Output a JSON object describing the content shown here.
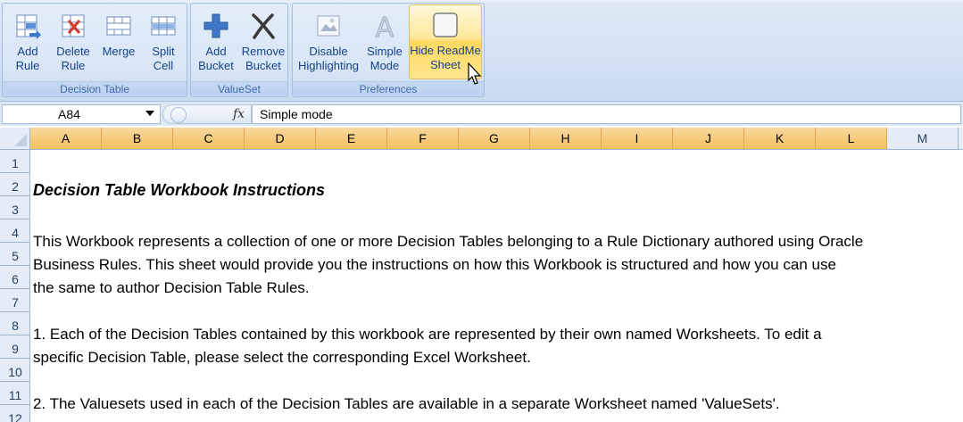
{
  "ribbon": {
    "groups": [
      {
        "label": "Decision Table",
        "buttons": [
          {
            "line1": "Add",
            "line2": "Rule",
            "icon": "add-rule-icon"
          },
          {
            "line1": "Delete",
            "line2": "Rule",
            "icon": "delete-rule-icon"
          },
          {
            "line1": "Merge",
            "line2": "",
            "icon": "merge-icon"
          },
          {
            "line1": "Split",
            "line2": "Cell",
            "icon": "split-cell-icon"
          }
        ]
      },
      {
        "label": "ValueSet",
        "buttons": [
          {
            "line1": "Add",
            "line2": "Bucket",
            "icon": "add-bucket-icon"
          },
          {
            "line1": "Remove",
            "line2": "Bucket",
            "icon": "remove-bucket-icon"
          }
        ]
      },
      {
        "label": "Preferences",
        "buttons": [
          {
            "line1": "Disable",
            "line2": "Highlighting",
            "icon": "disable-highlighting-icon"
          },
          {
            "line1": "Simple",
            "line2": "Mode",
            "icon": "simple-mode-icon"
          },
          {
            "line1": "Hide ReadMe",
            "line2": "Sheet",
            "icon": "hide-readme-icon",
            "active": true
          }
        ]
      }
    ]
  },
  "formula_bar": {
    "name_box": "A84",
    "fx": "fx",
    "content": "Simple mode"
  },
  "columns": [
    "A",
    "B",
    "C",
    "D",
    "E",
    "F",
    "G",
    "H",
    "I",
    "J",
    "K",
    "L",
    "M"
  ],
  "rows": [
    "1",
    "2",
    "3",
    "4",
    "5",
    "6",
    "7",
    "8",
    "9",
    "10",
    "11",
    "12"
  ],
  "sheet": {
    "title": "Decision Table Workbook Instructions",
    "para1_line1": "This Workbook represents a collection of one or more Decision Tables belonging to a Rule Dictionary authored using Oracle",
    "para1_line2": "Business Rules. This sheet would provide you the instructions on how this Workbook is structured and how you can use",
    "para1_line3": "the same to author Decision Table Rules.",
    "item1_line1": " 1. Each of the Decision Tables contained by this workbook are represented by their own named Worksheets.  To edit a",
    "item1_line2": "specific Decision Table, please select the corresponding Excel Worksheet.",
    "item2_line1": " 2. The Valuesets used in each of the Decision Tables are available in a separate Worksheet named 'ValueSets'."
  },
  "colors": {
    "ribbon_text": "#15428b",
    "selected_column": "#f1c15f",
    "header_bg": "#e4ecf7"
  }
}
